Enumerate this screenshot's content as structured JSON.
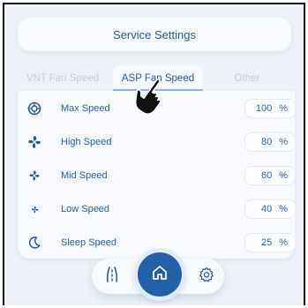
{
  "header": {
    "title": "Service Settings"
  },
  "tabs": [
    {
      "label": "VNT Fan Speed",
      "active": false
    },
    {
      "label": "ASP Fan Speed",
      "active": true
    },
    {
      "label": "Other",
      "active": false
    }
  ],
  "rows": [
    {
      "icon": "max-fan-icon",
      "label": "Max Speed",
      "value": "100",
      "unit": "%"
    },
    {
      "icon": "high-fan-icon",
      "label": "High Speed",
      "value": "80",
      "unit": "%"
    },
    {
      "icon": "mid-fan-icon",
      "label": "Mid Speed",
      "value": "60",
      "unit": "%"
    },
    {
      "icon": "low-fan-icon",
      "label": "Low Speed",
      "value": "40",
      "unit": "%"
    },
    {
      "icon": "moon-icon",
      "label": "Sleep Speed",
      "value": "25",
      "unit": "%"
    }
  ],
  "nav": {
    "left_icon": "road-icon",
    "center_icon": "home-icon",
    "right_icon": "gear-icon"
  },
  "colors": {
    "accent": "#2460a8",
    "text": "#2c5f9c",
    "inactive_tab": "#c4cedb",
    "background": "#eef2f8"
  }
}
